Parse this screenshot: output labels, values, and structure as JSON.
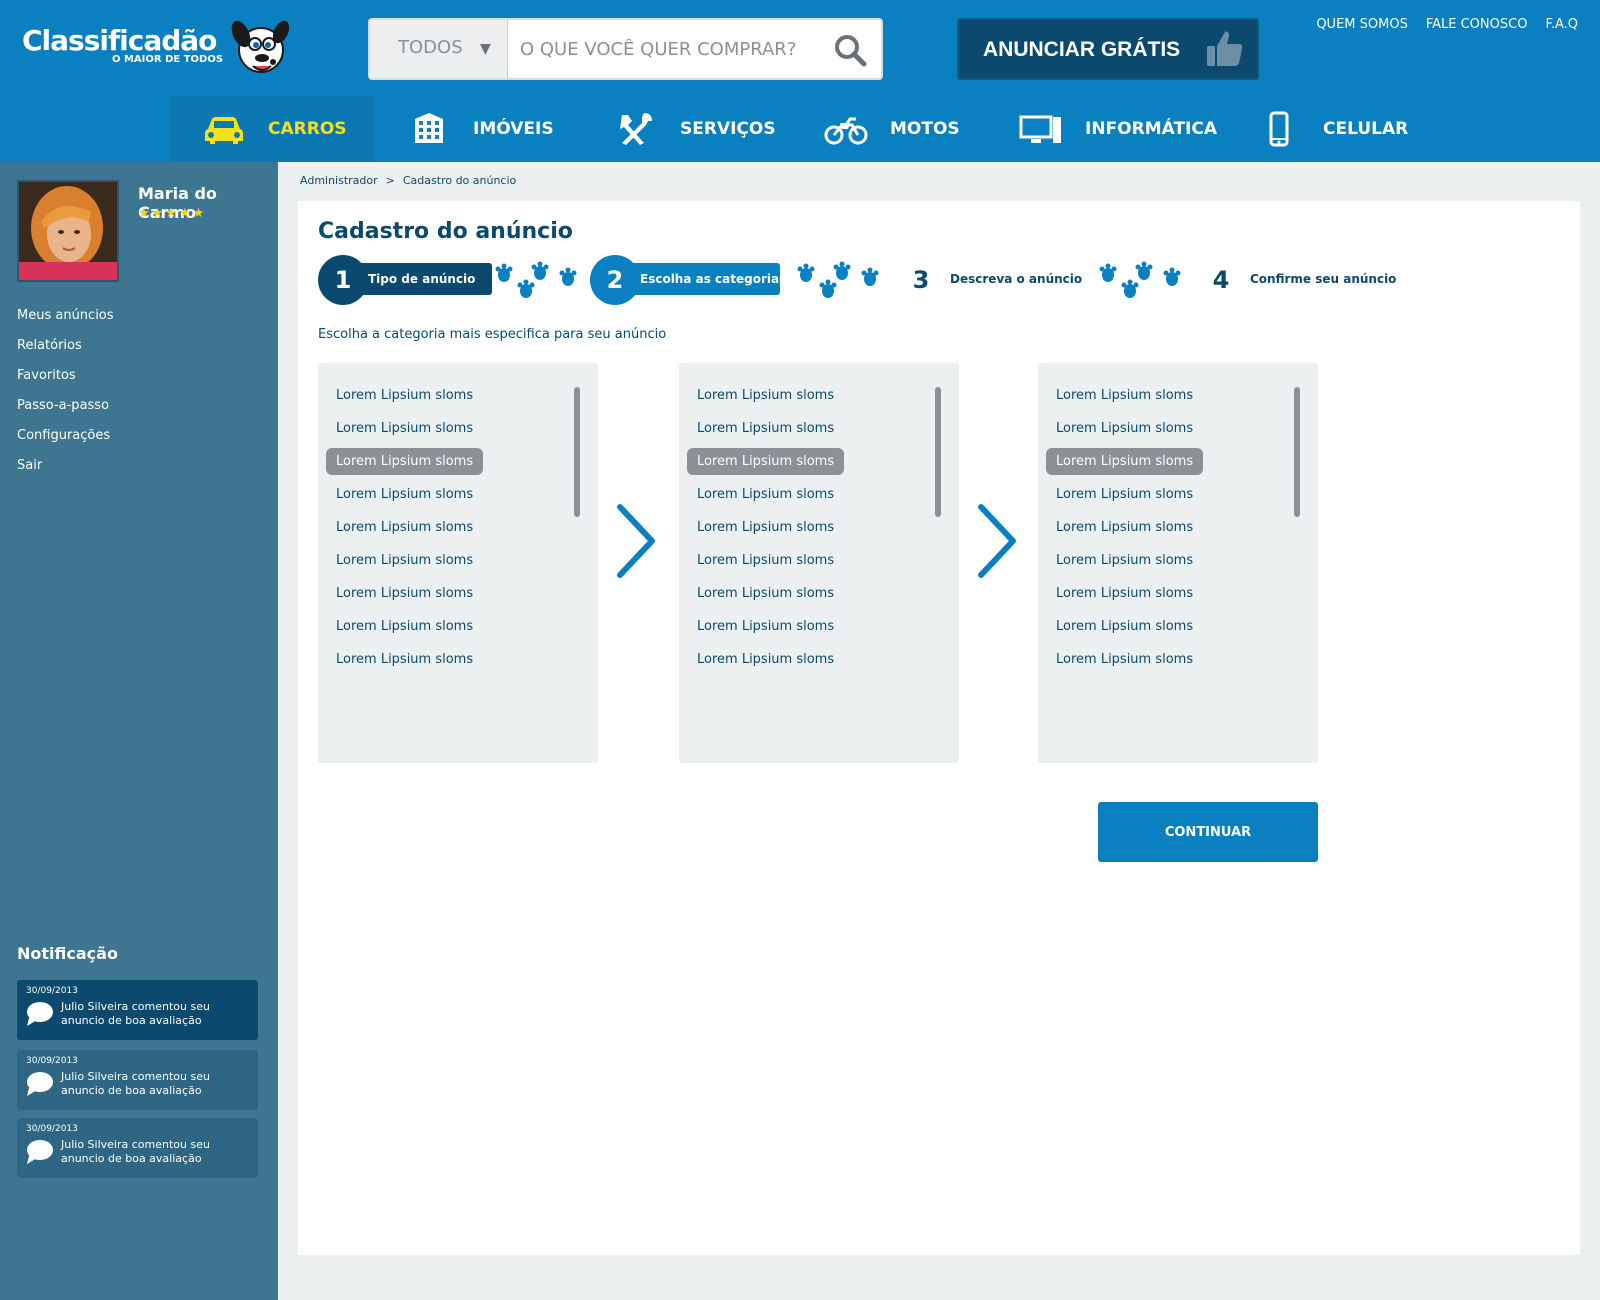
{
  "logo": {
    "title": "Classificadão",
    "subtitle": "O MAIOR DE TODOS"
  },
  "search": {
    "category": "TODOS",
    "placeholder": "O QUE VOCÊ QUER COMPRAR?"
  },
  "anunciar_label": "ANUNCIAR GRÁTIS",
  "top_links": [
    "QUEM SOMOS",
    "FALE CONOSCO",
    "F.A.Q"
  ],
  "nav": [
    {
      "label": "CARROS",
      "icon": "car-icon",
      "active": true
    },
    {
      "label": "IMÓVEIS",
      "icon": "building-icon"
    },
    {
      "label": "SERVIÇOS",
      "icon": "tools-icon"
    },
    {
      "label": "MOTOS",
      "icon": "motorcycle-icon"
    },
    {
      "label": "INFORMÁTICA",
      "icon": "computer-icon"
    },
    {
      "label": "CELULAR",
      "icon": "phone-icon"
    }
  ],
  "user": {
    "name": "Maria do Carmo",
    "stars": "★★★★★"
  },
  "side_menu": [
    "Meus anúncios",
    "Relatórios",
    "Favoritos",
    "Passo-a-passo",
    "Configurações",
    "Sair"
  ],
  "notifications": {
    "title": "Notificação",
    "items": [
      {
        "date": "30/09/2013",
        "text": "Julio Silveira comentou seu anuncio de boa avaliação"
      },
      {
        "date": "30/09/2013",
        "text": "Julio Silveira comentou seu anuncio de boa avaliação"
      },
      {
        "date": "30/09/2013",
        "text": "Julio Silveira comentou seu anuncio de boa avaliação"
      }
    ]
  },
  "breadcrumb": [
    "Administrador",
    ">",
    "Cadastro do anúncio"
  ],
  "page_title": "Cadastro do anúncio",
  "steps": [
    {
      "num": "1",
      "label": "Tipo de anúncio"
    },
    {
      "num": "2",
      "label": "Escolha as categorias"
    },
    {
      "num": "3",
      "label": "Descreva o anúncio"
    },
    {
      "num": "4",
      "label": "Confirme seu anúncio"
    }
  ],
  "instruction": "Escolha a categoria mais especifica para seu anúncio",
  "columns": [
    {
      "selected_index": 2,
      "items": [
        "Lorem Lipsium sloms",
        "Lorem Lipsium sloms",
        "Lorem Lipsium sloms",
        "Lorem Lipsium sloms",
        "Lorem Lipsium sloms",
        "Lorem Lipsium sloms",
        "Lorem Lipsium sloms",
        "Lorem Lipsium sloms",
        "Lorem Lipsium sloms"
      ]
    },
    {
      "selected_index": 2,
      "items": [
        "Lorem Lipsium sloms",
        "Lorem Lipsium sloms",
        "Lorem Lipsium sloms",
        "Lorem Lipsium sloms",
        "Lorem Lipsium sloms",
        "Lorem Lipsium sloms",
        "Lorem Lipsium sloms",
        "Lorem Lipsium sloms",
        "Lorem Lipsium sloms"
      ]
    },
    {
      "selected_index": 2,
      "items": [
        "Lorem Lipsium sloms",
        "Lorem Lipsium sloms",
        "Lorem Lipsium sloms",
        "Lorem Lipsium sloms",
        "Lorem Lipsium sloms",
        "Lorem Lipsium sloms",
        "Lorem Lipsium sloms",
        "Lorem Lipsium sloms",
        "Lorem Lipsium sloms"
      ]
    }
  ],
  "continue_label": "CONTINUAR",
  "colors": {
    "primary": "#0a80c0",
    "dark": "#0b4a6e",
    "sidebar": "#3e7590",
    "accent": "#f4e11c",
    "selected": "#8a9297"
  }
}
